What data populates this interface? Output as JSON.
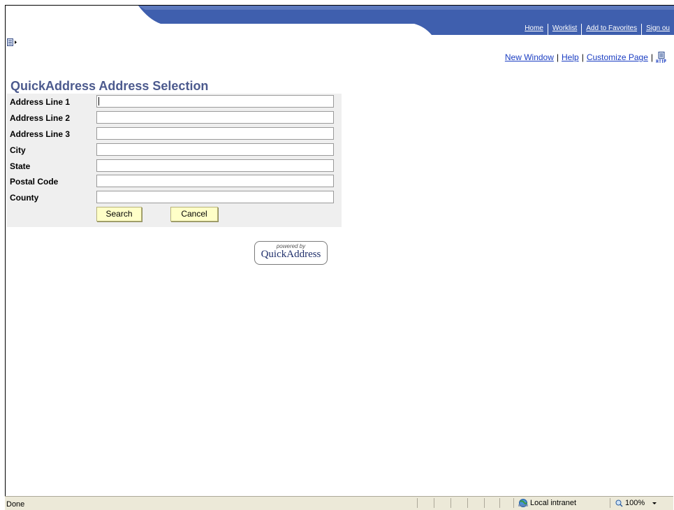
{
  "header": {
    "nav": [
      "Home",
      "Worklist",
      "Add to Favorites",
      "Sign ou"
    ]
  },
  "toplinks": {
    "new_window": "New Window",
    "help": "Help",
    "customize_page": "Customize Page",
    "separator": "|"
  },
  "page": {
    "title": "QuickAddress Address Selection"
  },
  "form": {
    "fields": [
      {
        "label": "Address Line 1",
        "value": ""
      },
      {
        "label": "Address Line 2",
        "value": ""
      },
      {
        "label": "Address Line 3",
        "value": ""
      },
      {
        "label": "City",
        "value": ""
      },
      {
        "label": "State",
        "value": ""
      },
      {
        "label": "Postal Code",
        "value": ""
      },
      {
        "label": "County",
        "value": ""
      }
    ],
    "search_label": "Search",
    "cancel_label": "Cancel"
  },
  "logo": {
    "powered_by": "powered by",
    "brand": "QuickAddress"
  },
  "statusbar": {
    "status": "Done",
    "zone": "Local intranet",
    "zoom": "100%"
  },
  "colors": {
    "banner": "#3f5fae",
    "title": "#4c5a8e",
    "panel": "#efefef",
    "button": "#ffffc8"
  },
  "icons": [
    "page-bar-icon",
    "http-icon",
    "globe-icon",
    "zoom-icon",
    "dropdown-arrow-icon"
  ]
}
